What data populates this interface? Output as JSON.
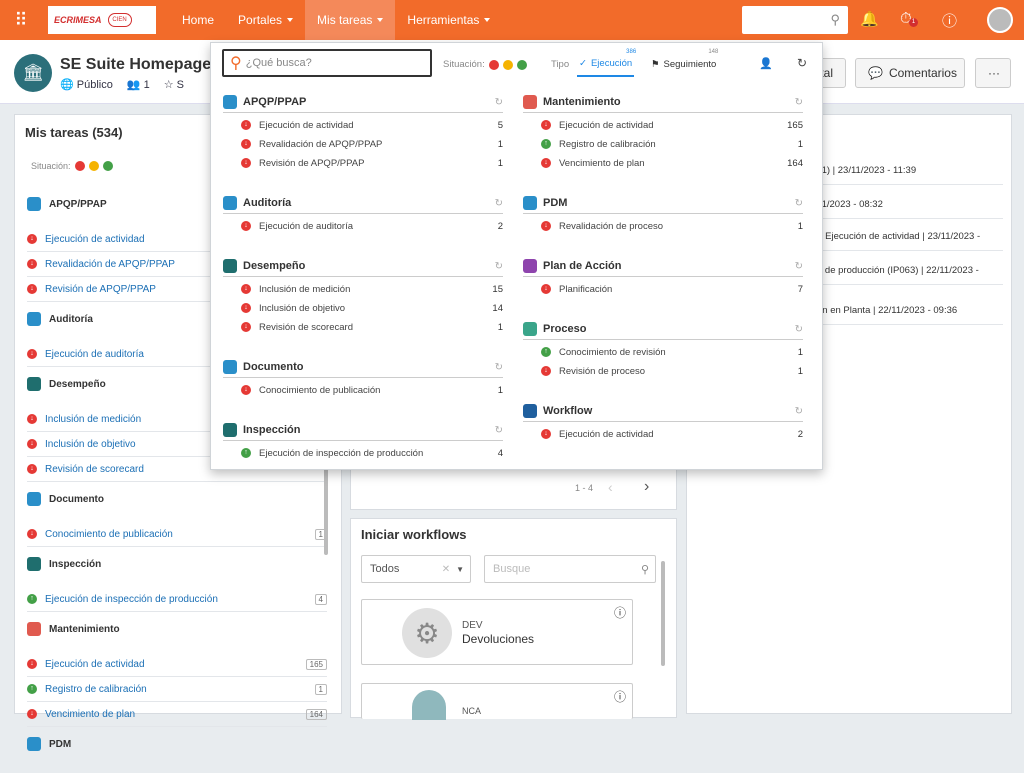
{
  "topbar": {
    "logo_main": "ECRIMESA",
    "logo_sub": "CIEN",
    "nav": [
      {
        "label": "Home"
      },
      {
        "label": "Portales"
      },
      {
        "label": "Mis tareas"
      },
      {
        "label": "Herramientas"
      }
    ],
    "notification_count": "1"
  },
  "header": {
    "title": "SE Suite Homepage",
    "visibility": "Público",
    "members": "1",
    "extra": "S",
    "btn_partial": "tal",
    "btn_comments": "Comentarios",
    "btn_more": "···"
  },
  "tasks_panel": {
    "title": "Mis tareas (534)",
    "situation_label": "Situación:",
    "groups": [
      {
        "name": "APQP/PPAP",
        "color": "#2a8fc9",
        "items": [
          {
            "label": "Ejecución de actividad",
            "status": "red"
          },
          {
            "label": "Revalidación de APQP/PPAP",
            "status": "red"
          },
          {
            "label": "Revisión de APQP/PPAP",
            "status": "red"
          }
        ]
      },
      {
        "name": "Auditoría",
        "color": "#2a8fc9",
        "items": [
          {
            "label": "Ejecución de auditoría",
            "status": "red"
          }
        ]
      },
      {
        "name": "Desempeño",
        "color": "#1f6e6e",
        "items": [
          {
            "label": "Inclusión de medición",
            "status": "red"
          },
          {
            "label": "Inclusión de objetivo",
            "status": "red"
          },
          {
            "label": "Revisión de scorecard",
            "status": "red"
          }
        ]
      },
      {
        "name": "Documento",
        "color": "#2a8fc9",
        "items": [
          {
            "label": "Conocimiento de publicación",
            "status": "red",
            "count": "1"
          }
        ]
      },
      {
        "name": "Inspección",
        "color": "#1f6e6e",
        "items": [
          {
            "label": "Ejecución de inspección de producción",
            "status": "grn",
            "count": "4"
          }
        ]
      },
      {
        "name": "Mantenimiento",
        "color": "#e05a4f",
        "items": [
          {
            "label": "Ejecución de actividad",
            "status": "red",
            "count": "165"
          },
          {
            "label": "Registro de calibración",
            "status": "grn",
            "count": "1"
          },
          {
            "label": "Vencimiento de plan",
            "status": "red",
            "count": "164"
          }
        ]
      },
      {
        "name": "PDM",
        "color": "#2a8fc9",
        "items": []
      }
    ]
  },
  "dropdown": {
    "search_placeholder": "¿Qué busca?",
    "situation_label": "Situación:",
    "tipo_label": "Tipo",
    "tab_ejecucion": "Ejecución",
    "tab_ejecucion_count": "386",
    "tab_seguimiento": "Seguimiento",
    "tab_seguimiento_count": "148",
    "left": [
      {
        "name": "APQP/PPAP",
        "color": "#2a8fc9",
        "items": [
          {
            "label": "Ejecución de actividad",
            "n": "5",
            "status": "red"
          },
          {
            "label": "Revalidación de APQP/PPAP",
            "n": "1",
            "status": "red"
          },
          {
            "label": "Revisión de APQP/PPAP",
            "n": "1",
            "status": "red"
          }
        ]
      },
      {
        "name": "Auditoría",
        "color": "#2a8fc9",
        "items": [
          {
            "label": "Ejecución de auditoría",
            "n": "2",
            "status": "red"
          }
        ]
      },
      {
        "name": "Desempeño",
        "color": "#1f6e6e",
        "items": [
          {
            "label": "Inclusión de medición",
            "n": "15",
            "status": "red"
          },
          {
            "label": "Inclusión de objetivo",
            "n": "14",
            "status": "red"
          },
          {
            "label": "Revisión de scorecard",
            "n": "1",
            "status": "red"
          }
        ]
      },
      {
        "name": "Documento",
        "color": "#2a8fc9",
        "items": [
          {
            "label": "Conocimiento de publicación",
            "n": "1",
            "status": "red"
          }
        ]
      },
      {
        "name": "Inspección",
        "color": "#1f6e6e",
        "items": [
          {
            "label": "Ejecución de inspección de producción",
            "n": "4",
            "status": "grn"
          }
        ]
      }
    ],
    "right": [
      {
        "name": "Mantenimiento",
        "color": "#e05a4f",
        "items": [
          {
            "label": "Ejecución de actividad",
            "n": "165",
            "status": "red"
          },
          {
            "label": "Registro de calibración",
            "n": "1",
            "status": "grn"
          },
          {
            "label": "Vencimiento de plan",
            "n": "164",
            "status": "red"
          }
        ]
      },
      {
        "name": "PDM",
        "color": "#2a8fc9",
        "items": [
          {
            "label": "Revalidación de proceso",
            "n": "1",
            "status": "red"
          }
        ]
      },
      {
        "name": "Plan de Acción",
        "color": "#8e44ad",
        "items": [
          {
            "label": "Planificación",
            "n": "7",
            "status": "red"
          }
        ]
      },
      {
        "name": "Proceso",
        "color": "#3aa58a",
        "items": [
          {
            "label": "Conocimiento de revisión",
            "n": "1",
            "status": "grn"
          },
          {
            "label": "Revisión de proceso",
            "n": "1",
            "status": "red"
          }
        ]
      },
      {
        "name": "Workflow",
        "color": "#1f5f9e",
        "items": [
          {
            "label": "Ejecución de actividad",
            "n": "2",
            "status": "red"
          }
        ]
      }
    ]
  },
  "middle": {
    "pager": "1 - 4",
    "workflows_title": "Iniciar workflows",
    "filter_value": "Todos",
    "search_placeholder": "Busque",
    "wf_code": "DEV",
    "wf_name": "Devoluciones",
    "wf2_code": "NCA"
  },
  "activity": [
    {
      "text": "11) | 23/11/2023 - 11:39"
    },
    {
      "text": "11/2023 - 08:32"
    },
    {
      "text": "> Ejecución de actividad | 23/11/2023 -"
    },
    {
      "text": "n de producción (IP063) | 22/11/2023 -"
    },
    {
      "text": "ón en Planta | 22/11/2023 - 09:36"
    }
  ]
}
